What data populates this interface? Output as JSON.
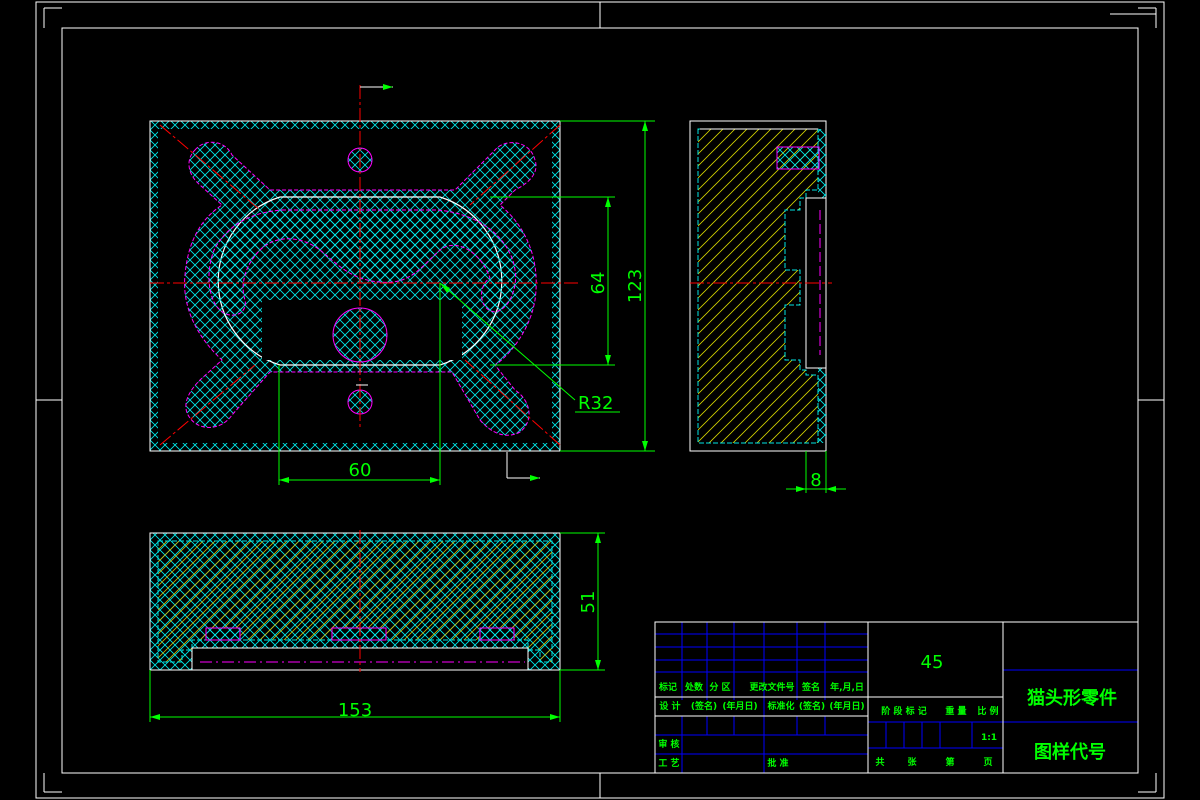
{
  "drawing": {
    "dimensions": {
      "width_total": "153",
      "height_total": "123",
      "slot_height": "64",
      "offset": "60",
      "radius": "R32",
      "side_depth": "8",
      "front_height": "51"
    },
    "title_block": {
      "material": "45",
      "part_name": "猫头形零件",
      "drawing_code": "图样代号",
      "scale": "1:1",
      "headers": [
        "标记",
        "处数",
        "分 区",
        "更改文件号",
        "签名",
        "年,月,日"
      ],
      "row_design": [
        "设 计",
        "(签名)",
        "(年月日)",
        "标准化",
        "(签名)",
        "(年月日)"
      ],
      "row_review": "审 核",
      "row_process": "工 艺",
      "row_approve": "批 准",
      "stage_labels": [
        "阶 段 标 记",
        "重 量",
        "比 例"
      ],
      "sheet_labels": [
        "共",
        "张",
        "第",
        "页"
      ]
    },
    "colors": {
      "background": "#000000",
      "outline": "#ffffff",
      "dimension": "#00ff00",
      "center": "#ff0000",
      "hatch": "#00ffff",
      "hidden": "#ff00ff",
      "table_grid": "#0000ff"
    }
  }
}
